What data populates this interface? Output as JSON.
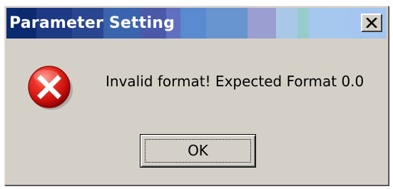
{
  "dialog": {
    "title": "Parameter Setting",
    "titlebar_colors": [
      "#0a246a",
      "#1a3c86",
      "#2c4c96",
      "#3a68b8",
      "#5a6ec8",
      "#6888c8",
      "#8aa4d8",
      "#9aa2d2",
      "#a8bfe0",
      "#bcd0ec",
      "#a6ccd6",
      "#b8d2f0",
      "#a8c8f0"
    ],
    "message": "Invalid format! Expected Format 0.0",
    "icon": "error-icon",
    "ok_label": "OK",
    "close_icon": "close-icon"
  }
}
